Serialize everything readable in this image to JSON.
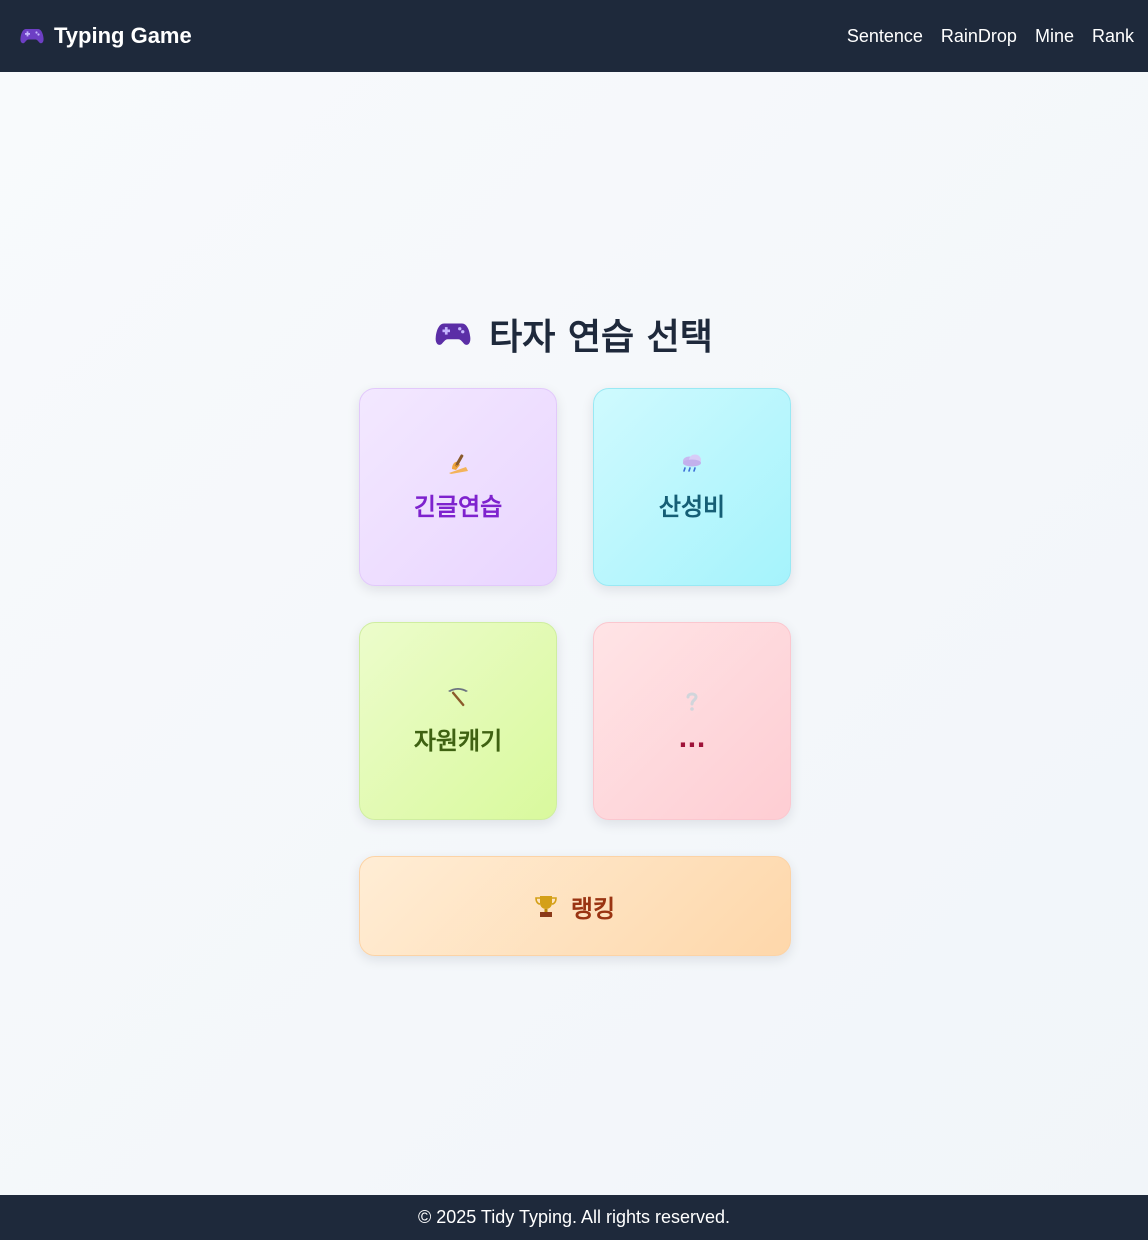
{
  "navbar": {
    "brand_icon": "gamepad-icon",
    "brand": "Typing Game",
    "links": [
      "Sentence",
      "RainDrop",
      "Mine",
      "Rank"
    ]
  },
  "main": {
    "title_icon": "gamepad-icon",
    "title": "타자 연습 선택",
    "cards": [
      {
        "icon": "writing-hand-icon",
        "label": "긴글연습"
      },
      {
        "icon": "rain-cloud-icon",
        "label": "산성비"
      },
      {
        "icon": "pickaxe-icon",
        "label": "자원캐기"
      },
      {
        "icon": "question-mark-icon",
        "label": "..."
      }
    ],
    "ranking": {
      "icon": "trophy-icon",
      "label": "랭킹"
    }
  },
  "footer": {
    "text": "© 2025 Tidy Typing. All rights reserved."
  },
  "colors": {
    "navbar_bg": "#1e293b",
    "card_purple": "#e9d5ff",
    "card_cyan": "#a5f3fc",
    "card_lime": "#d9f99d",
    "card_pink": "#fecdd3",
    "ranking_orange": "#fed7aa"
  }
}
